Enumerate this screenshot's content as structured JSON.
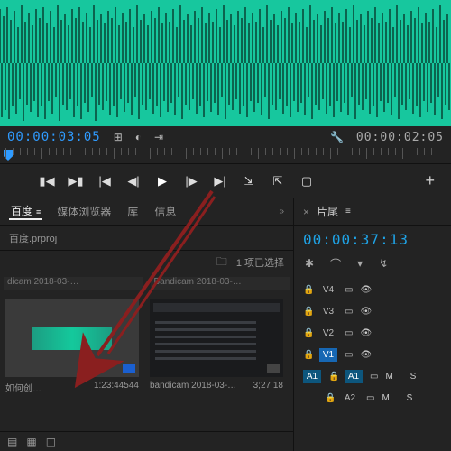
{
  "source": {
    "in_timecode": "00:00:03:05",
    "out_timecode": "00:00:02:05"
  },
  "transport": {
    "mark_in": "{",
    "mark_out": "}",
    "go_in": "|◀",
    "step_back": "◀|",
    "play": "▶",
    "step_fwd": "|▶",
    "go_out": "▶|",
    "insert": "□↘",
    "overwrite": "□↗",
    "export_frame": "📷",
    "add": "+"
  },
  "project": {
    "tabs": {
      "bin": "百度",
      "media_browser": "媒体浏览器",
      "library": "库",
      "info": "信息",
      "overflow": "»"
    },
    "file": "百度.prproj",
    "selection": "1 项已选择",
    "clips": [
      {
        "header": "dicam 2018-03-…",
        "name": "如何创…",
        "duration": "1:23:44544"
      },
      {
        "header": "Bandicam 2018-03-…",
        "name": "bandicam 2018-03-…",
        "duration": "3;27;18"
      }
    ]
  },
  "timeline": {
    "tab": "片尾",
    "timecode": "00:00:37:13",
    "tracks": {
      "v4": "V4",
      "v3": "V3",
      "v2": "V2",
      "v1": "V1",
      "a1": "A1",
      "m": "M",
      "s": "S"
    }
  }
}
